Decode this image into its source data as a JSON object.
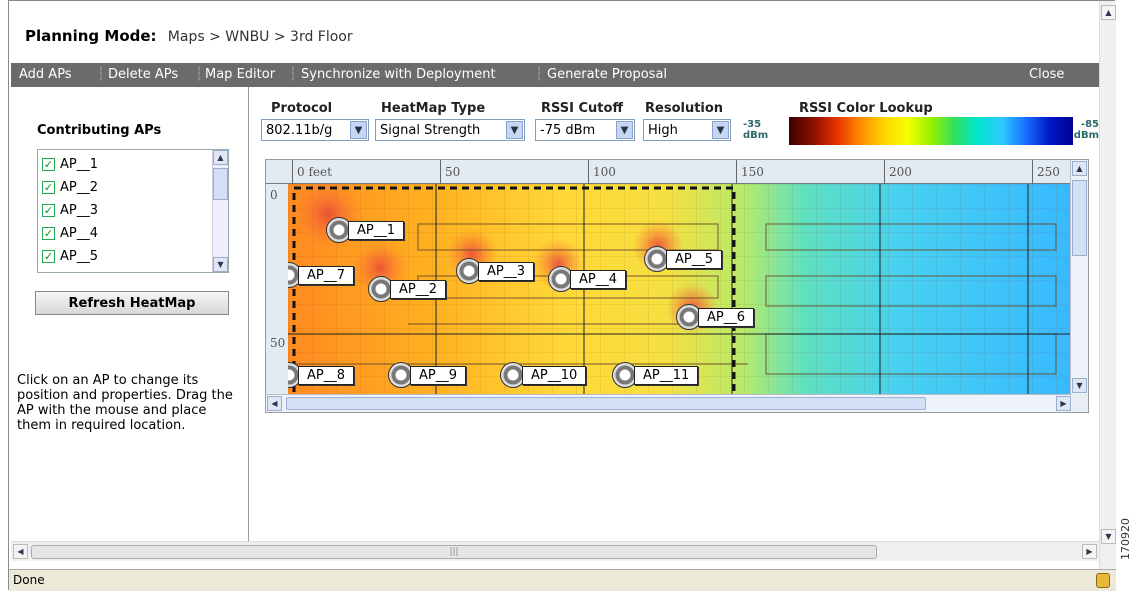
{
  "header": {
    "title": "Planning Mode:",
    "breadcrumb": "Maps > WNBU > 3rd Floor"
  },
  "menu": {
    "items": [
      "Add APs",
      "Delete APs",
      "Map Editor",
      "Synchronize with Deployment",
      "Generate Proposal"
    ],
    "close": "Close"
  },
  "sidebar": {
    "contributing_title": "Contributing APs",
    "aps": [
      "AP__1",
      "AP__2",
      "AP__3",
      "AP__4",
      "AP__5"
    ],
    "refresh_label": "Refresh HeatMap",
    "help": "Click on an AP to change its position and properties. Drag the AP with the mouse and place them in required location."
  },
  "controls": {
    "protocol_label": "Protocol",
    "protocol_value": "802.11b/g",
    "heatmap_label": "HeatMap Type",
    "heatmap_value": "Signal Strength",
    "rssi_label": "RSSI Cutoff",
    "rssi_value": "-75 dBm",
    "resolution_label": "Resolution",
    "resolution_value": "High",
    "lookup_label": "RSSI Color Lookup",
    "lookup_min": "-35",
    "lookup_max": "-85",
    "unit": "dBm"
  },
  "map": {
    "ruler_x": [
      "0 feet",
      "50",
      "100",
      "150",
      "200",
      "250"
    ],
    "ruler_y": [
      "0",
      "50"
    ],
    "ap_labels": [
      "AP__1",
      "AP__2",
      "AP__3",
      "AP__4",
      "AP__5",
      "AP__6",
      "AP__7",
      "AP__8",
      "AP__9",
      "AP__10",
      "AP__11"
    ]
  },
  "status": {
    "text": "Done"
  },
  "figure_id": "170920"
}
